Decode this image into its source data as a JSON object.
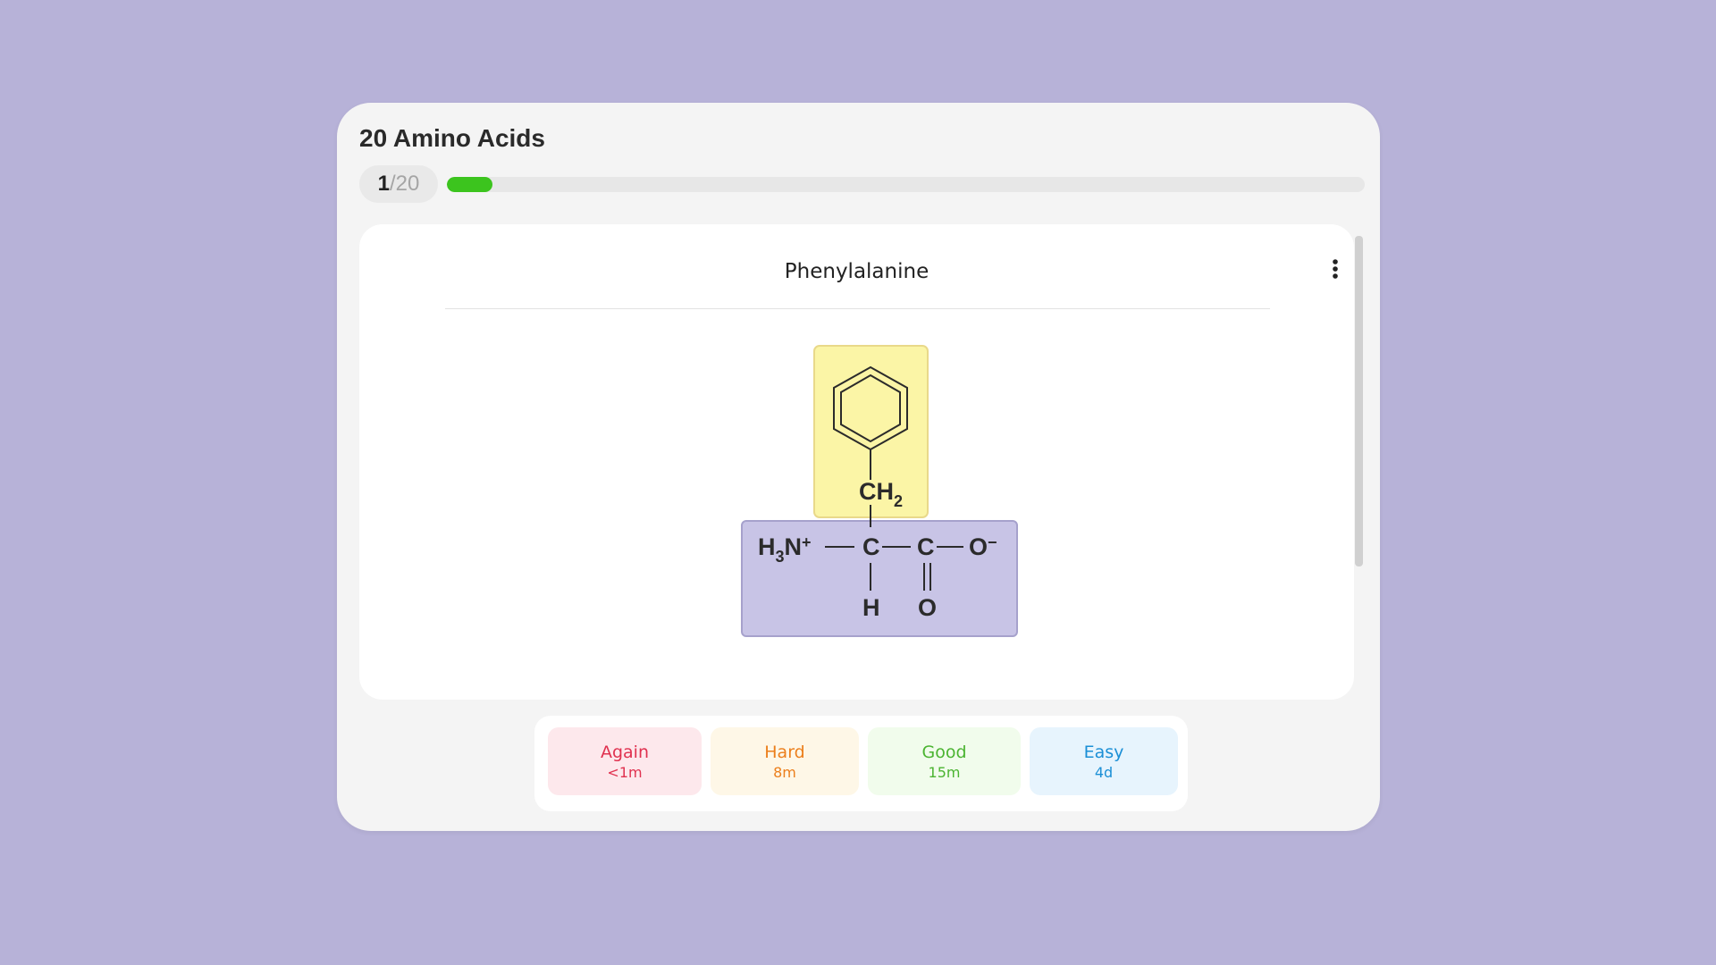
{
  "deck": {
    "title": "20 Amino Acids",
    "current": "1",
    "separator": "/",
    "total": "20",
    "progress_fraction": 0.05
  },
  "card": {
    "front": "Phenylalanine",
    "menu_icon": "more-vertical-icon",
    "structure": {
      "side_chain": "CH",
      "side_chain_sub": "2",
      "amine": "H",
      "amine_sub": "3",
      "amine_rest": "N",
      "amine_charge": "+",
      "alpha_carbon": "C",
      "carboxyl_carbon": "C",
      "carboxyl_oxygen": "O",
      "carboxyl_charge": "−",
      "alpha_h": "H",
      "carbonyl_oxygen": "O",
      "side_chain_color": "#fbf5a6",
      "backbone_color": "#c8c4e6"
    }
  },
  "answers": [
    {
      "label": "Again",
      "interval": "<1m",
      "color": "#e0314f"
    },
    {
      "label": "Hard",
      "interval": "8m",
      "color": "#ec7f1c"
    },
    {
      "label": "Good",
      "interval": "15m",
      "color": "#4bb431"
    },
    {
      "label": "Easy",
      "interval": "4d",
      "color": "#1b8fd6"
    }
  ]
}
